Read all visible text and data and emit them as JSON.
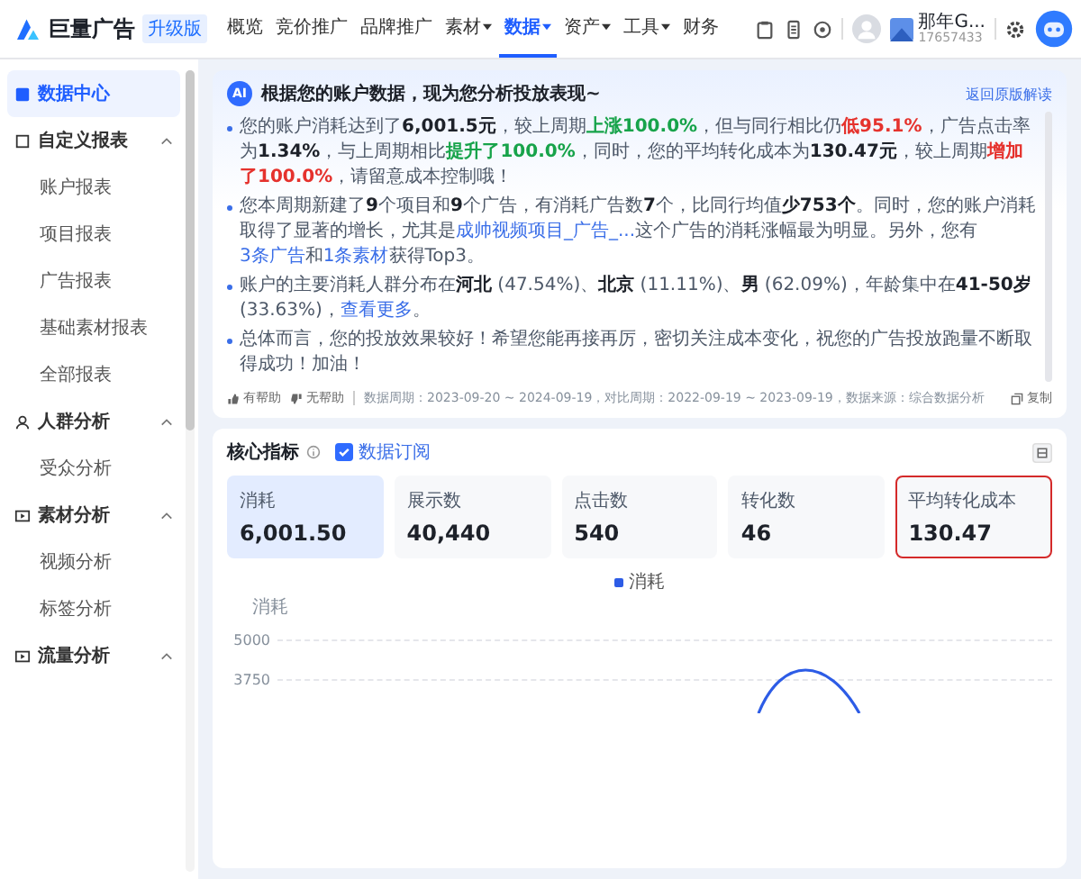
{
  "brand": {
    "name": "巨量广告",
    "badge": "升级版"
  },
  "nav": [
    {
      "label": "概览",
      "selected": false,
      "dropdown": false
    },
    {
      "label": "竞价推广",
      "selected": false,
      "dropdown": false
    },
    {
      "label": "品牌推广",
      "selected": false,
      "dropdown": false
    },
    {
      "label": "素材",
      "selected": false,
      "dropdown": true
    },
    {
      "label": "数据",
      "selected": true,
      "dropdown": true
    },
    {
      "label": "资产",
      "selected": false,
      "dropdown": true
    },
    {
      "label": "工具",
      "selected": false,
      "dropdown": true
    },
    {
      "label": "财务",
      "selected": false,
      "dropdown": false
    }
  ],
  "account": {
    "name": "那年G...",
    "id": "17657433"
  },
  "sidebar": {
    "items": [
      {
        "label": "数据中心",
        "kind": "home",
        "selected": true
      },
      {
        "label": "自定义报表",
        "kind": "report",
        "selected": false,
        "expanded": true,
        "children": [
          {
            "label": "账户报表"
          },
          {
            "label": "项目报表"
          },
          {
            "label": "广告报表"
          },
          {
            "label": "基础素材报表"
          },
          {
            "label": "全部报表"
          }
        ]
      },
      {
        "label": "人群分析",
        "kind": "people",
        "selected": false,
        "expanded": true,
        "children": [
          {
            "label": "受众分析"
          }
        ]
      },
      {
        "label": "素材分析",
        "kind": "media",
        "selected": false,
        "expanded": true,
        "children": [
          {
            "label": "视频分析"
          },
          {
            "label": "标签分析"
          }
        ]
      },
      {
        "label": "流量分析",
        "kind": "media",
        "selected": false,
        "expanded": true
      }
    ]
  },
  "insight": {
    "badge": "AI",
    "title": "根据您的账户数据，现为您分析投放表现~",
    "back_link": "返回原版解读",
    "points": [
      [
        {
          "kind": "plain",
          "text": "您的账户消耗达到了"
        },
        {
          "kind": "bold",
          "text": "6,001.5元"
        },
        {
          "kind": "plain",
          "text": "，较上周期"
        },
        {
          "kind": "up",
          "text": "上涨100.0%"
        },
        {
          "kind": "plain",
          "text": "，但与同行相比仍"
        },
        {
          "kind": "down",
          "text": "低95.1%"
        },
        {
          "kind": "plain",
          "text": "，广告点击率为"
        },
        {
          "kind": "bold",
          "text": "1.34%"
        },
        {
          "kind": "plain",
          "text": "，与上周期相比"
        },
        {
          "kind": "up",
          "text": "提升了100.0%"
        },
        {
          "kind": "plain",
          "text": "，同时，您的平均转化成本为"
        },
        {
          "kind": "bold",
          "text": "130.47元"
        },
        {
          "kind": "plain",
          "text": "，较上周期"
        },
        {
          "kind": "down",
          "text": "增加了100.0%"
        },
        {
          "kind": "plain",
          "text": "，请留意成本控制哦！"
        }
      ],
      [
        {
          "kind": "plain",
          "text": "您本周期新建了"
        },
        {
          "kind": "bold",
          "text": "9"
        },
        {
          "kind": "plain",
          "text": "个项目和"
        },
        {
          "kind": "bold",
          "text": "9"
        },
        {
          "kind": "plain",
          "text": "个广告，有消耗广告数"
        },
        {
          "kind": "bold",
          "text": "7"
        },
        {
          "kind": "plain",
          "text": "个，比同行均值"
        },
        {
          "kind": "bold",
          "text": "少753个"
        },
        {
          "kind": "plain",
          "text": "。同时，您的账户消耗取得了显著的增长，尤其是"
        },
        {
          "kind": "link",
          "text": "成帅视频项目_广告_..."
        },
        {
          "kind": "plain",
          "text": "这个广告的消耗涨幅最为明显。另外，您有"
        },
        {
          "kind": "link",
          "text": "3条广告"
        },
        {
          "kind": "plain",
          "text": "和"
        },
        {
          "kind": "link",
          "text": "1条素材"
        },
        {
          "kind": "plain",
          "text": "获得Top3。"
        }
      ],
      [
        {
          "kind": "plain",
          "text": "账户的主要消耗人群分布在"
        },
        {
          "kind": "bold",
          "text": "河北"
        },
        {
          "kind": "plain",
          "text": " (47.54%)、"
        },
        {
          "kind": "bold",
          "text": "北京"
        },
        {
          "kind": "plain",
          "text": " (11.11%)、"
        },
        {
          "kind": "bold",
          "text": "男"
        },
        {
          "kind": "plain",
          "text": " (62.09%)，年龄集中在"
        },
        {
          "kind": "bold",
          "text": "41-50岁"
        },
        {
          "kind": "plain",
          "text": " (33.63%)，"
        },
        {
          "kind": "link",
          "text": "查看更多"
        },
        {
          "kind": "plain",
          "text": "。"
        }
      ],
      [
        {
          "kind": "plain",
          "text": "总体而言，您的投放效果较好！希望您能再接再厉，密切关注成本变化，祝您的广告投放跑量不断取得成功！加油！"
        }
      ]
    ],
    "helpful": "有帮助",
    "unhelpful": "无帮助",
    "period": "数据周期：2023-09-20 ~ 2024-09-19，对比周期：2022-09-19 ~ 2023-09-19，数据来源：综合数据分析",
    "copy": "复制"
  },
  "metrics": {
    "title": "核心指标",
    "subscribe": {
      "label": "数据订阅",
      "checked": true
    },
    "tiles": [
      {
        "label": "消耗",
        "value": "6,001.50",
        "selected": true,
        "highlighted": false
      },
      {
        "label": "展示数",
        "value": "40,440",
        "selected": false,
        "highlighted": false
      },
      {
        "label": "点击数",
        "value": "540",
        "selected": false,
        "highlighted": false
      },
      {
        "label": "转化数",
        "value": "46",
        "selected": false,
        "highlighted": false
      },
      {
        "label": "平均转化成本",
        "value": "130.47",
        "selected": false,
        "highlighted": true
      }
    ],
    "chart": {
      "legend": "消耗",
      "axis_title": "消耗",
      "ticks": [
        "5000",
        "3750"
      ]
    }
  }
}
